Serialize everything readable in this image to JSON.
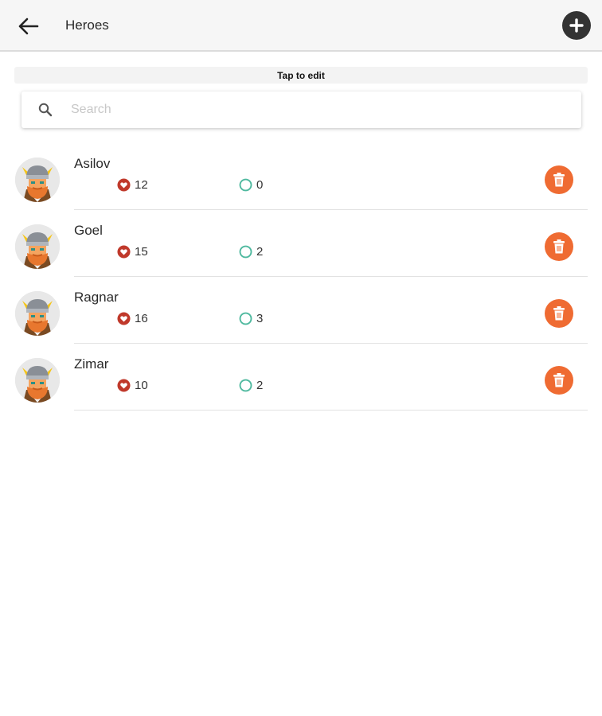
{
  "header": {
    "title": "Heroes",
    "back_icon": "arrow-left-icon",
    "add_icon": "plus-circle-icon"
  },
  "hint": {
    "text": "Tap to edit"
  },
  "search": {
    "placeholder": "Search",
    "value": ""
  },
  "colors": {
    "delete": "#ef6b32",
    "health": "#c0392b",
    "mana": "#4fb99f",
    "add": "#333333"
  },
  "heroes": [
    {
      "name": "Asilov",
      "health": "12",
      "mana": "0"
    },
    {
      "name": "Goel",
      "health": "15",
      "mana": "2"
    },
    {
      "name": "Ragnar",
      "health": "16",
      "mana": "3"
    },
    {
      "name": "Zimar",
      "health": "10",
      "mana": "2"
    }
  ]
}
